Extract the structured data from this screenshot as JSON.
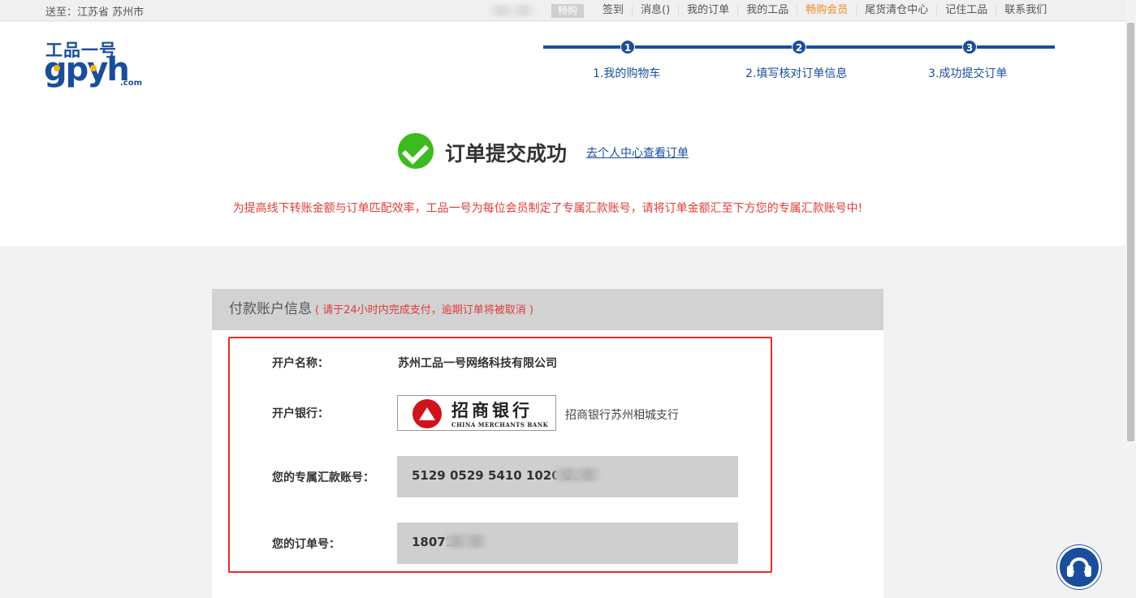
{
  "topbar": {
    "ship_to": "送至：江苏省 苏州市",
    "chang_badge": "畅购",
    "links": [
      {
        "label": "签到",
        "highlight": false
      },
      {
        "label": "消息()",
        "highlight": false
      },
      {
        "label": "我的订单",
        "highlight": false
      },
      {
        "label": "我的工品",
        "highlight": false
      },
      {
        "label": "畅购会员",
        "highlight": true
      },
      {
        "label": "尾货清仓中心",
        "highlight": false
      },
      {
        "label": "记住工品",
        "highlight": false
      },
      {
        "label": "联系我们",
        "highlight": false
      }
    ]
  },
  "logo": {
    "cn": "工品一号",
    "en": "gpyh",
    "com": ".com"
  },
  "steps": [
    {
      "num": "1",
      "label": "1.我的购物车"
    },
    {
      "num": "2",
      "label": "2.填写核对订单信息"
    },
    {
      "num": "3",
      "label": "3.成功提交订单"
    }
  ],
  "success": {
    "title": "订单提交成功",
    "link": "去个人中心查看订单"
  },
  "notice": "为提高线下转账金额与订单匹配效率，工品一号为每位会员制定了专属汇款账号，请将订单金额汇至下方您的专属汇款账号中!",
  "payment": {
    "header_title": "付款账户信息",
    "header_note": "( 请于24小时内完成支付，逾期订单将被取消 )",
    "account_name_label": "开户名称：",
    "account_name": "苏州工品一号网络科技有限公司",
    "bank_label": "开户银行：",
    "bank_logo_cn": "招商银行",
    "bank_logo_en": "CHINA MERCHANTS BANK",
    "bank_branch": "招商银行苏州相城支行",
    "account_no_label": "您的专属汇款账号：",
    "account_no": "5129 0529 5410 1020 00",
    "order_no_label": "您的订单号：",
    "order_no": "18071"
  },
  "colors": {
    "brand": "#1a4e9c",
    "accent": "#f08a24",
    "warning": "#e03b3b",
    "success": "#3dbb1e"
  },
  "icons": [
    "check-circle-icon",
    "headset-icon"
  ]
}
